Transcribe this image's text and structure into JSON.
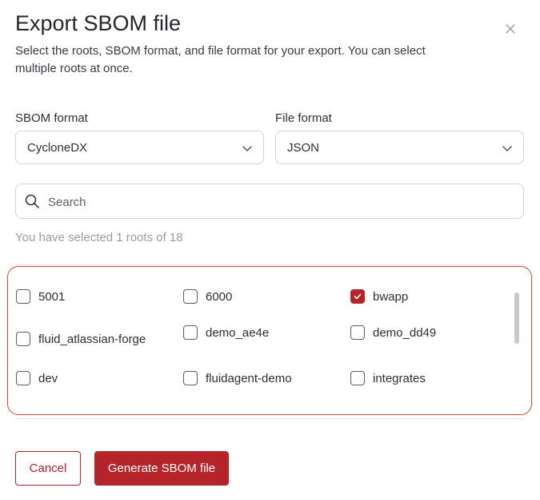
{
  "modal": {
    "title": "Export SBOM file",
    "description": "Select the roots, SBOM format, and file format for your export. You can select multiple roots at once."
  },
  "sbom_format": {
    "label": "SBOM format",
    "value": "CycloneDX"
  },
  "file_format": {
    "label": "File format",
    "value": "JSON"
  },
  "search": {
    "placeholder": "Search",
    "value": ""
  },
  "selection": {
    "summary": "You have selected 1 roots of 18",
    "selected_count": 1,
    "total": 18
  },
  "roots": [
    {
      "name": "5001",
      "checked": false
    },
    {
      "name": "6000",
      "checked": false
    },
    {
      "name": "bwapp",
      "checked": true
    },
    {
      "name": "fluid_atlassian-forge",
      "checked": false
    },
    {
      "name": "demo_ae4e",
      "checked": false
    },
    {
      "name": "demo_dd49",
      "checked": false
    },
    {
      "name": "dev",
      "checked": false
    },
    {
      "name": "fluidagent-demo",
      "checked": false
    },
    {
      "name": "integrates",
      "checked": false
    }
  ],
  "actions": {
    "cancel_label": "Cancel",
    "generate_label": "Generate SBOM file"
  },
  "colors": {
    "accent": "#b5242a",
    "highlight_border": "#d64a3a",
    "muted_text": "#9a9aa6"
  },
  "icons": {
    "close": "close-icon",
    "chevron": "chevron-down-icon",
    "search": "search-icon",
    "check": "check-icon"
  }
}
